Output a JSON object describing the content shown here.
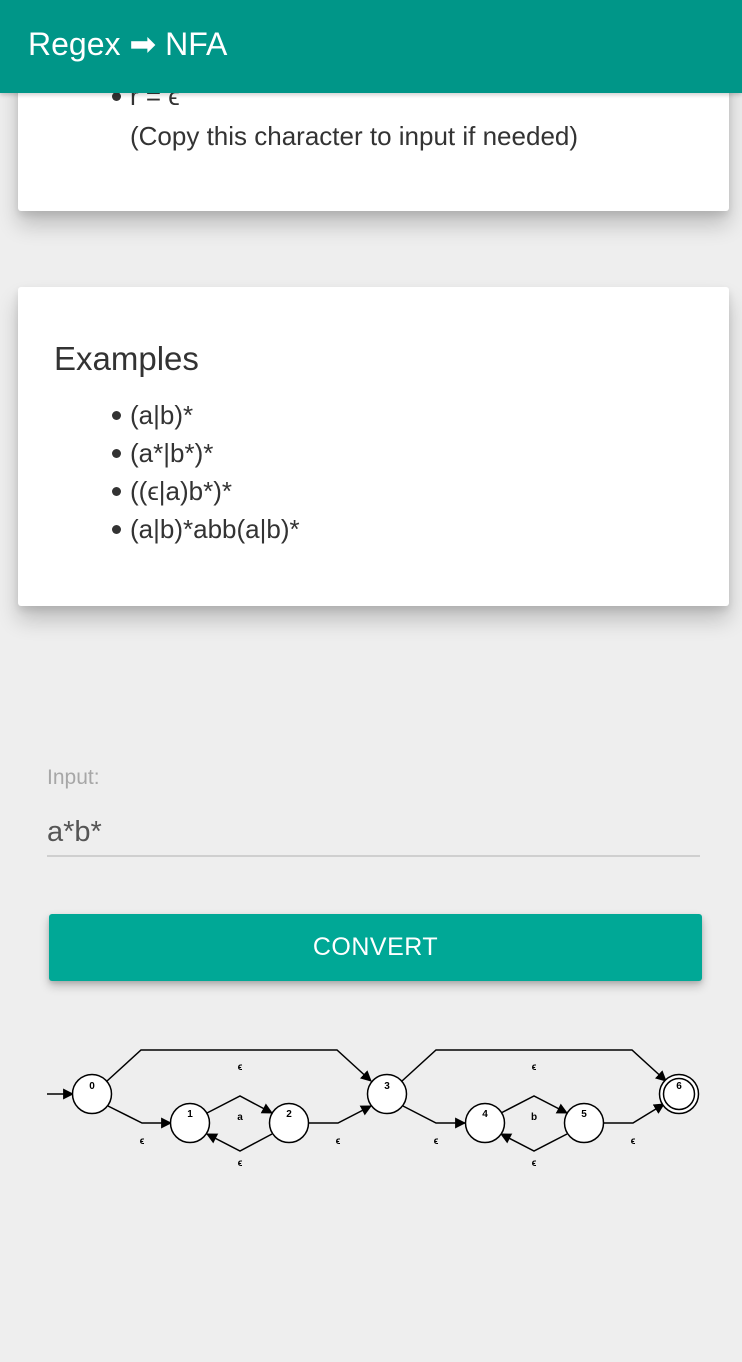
{
  "header": {
    "title": "Regex ➡ NFA"
  },
  "syntax_card": {
    "items": [
      {
        "label": "r = ϵ"
      }
    ],
    "note": "(Copy this character to input if needed)"
  },
  "examples_card": {
    "heading": "Examples",
    "items": [
      {
        "label": "(a|b)*"
      },
      {
        "label": "(a*|b*)*"
      },
      {
        "label": "((ϵ|a)b*)*"
      },
      {
        "label": "(a|b)*abb(a|b)*"
      }
    ]
  },
  "input": {
    "label": "Input:",
    "value": "a*b*"
  },
  "convert_button": {
    "label": "CONVERT"
  },
  "nfa": {
    "states": [
      {
        "label": "0",
        "start": true,
        "accept": false
      },
      {
        "label": "1",
        "start": false,
        "accept": false
      },
      {
        "label": "2",
        "start": false,
        "accept": false
      },
      {
        "label": "3",
        "start": false,
        "accept": false
      },
      {
        "label": "4",
        "start": false,
        "accept": false
      },
      {
        "label": "5",
        "start": false,
        "accept": false
      },
      {
        "label": "6",
        "start": false,
        "accept": true
      }
    ],
    "transitions": [
      {
        "from": "0",
        "to": "3",
        "symbol": "ϵ"
      },
      {
        "from": "0",
        "to": "1",
        "symbol": "ϵ"
      },
      {
        "from": "1",
        "to": "2",
        "symbol": "a"
      },
      {
        "from": "2",
        "to": "1",
        "symbol": "ϵ"
      },
      {
        "from": "2",
        "to": "3",
        "symbol": "ϵ"
      },
      {
        "from": "3",
        "to": "6",
        "symbol": "ϵ"
      },
      {
        "from": "3",
        "to": "4",
        "symbol": "ϵ"
      },
      {
        "from": "4",
        "to": "5",
        "symbol": "b"
      },
      {
        "from": "5",
        "to": "4",
        "symbol": "ϵ"
      },
      {
        "from": "5",
        "to": "6",
        "symbol": "ϵ"
      }
    ]
  },
  "colors": {
    "primary": "#009688",
    "button": "#00a896",
    "background": "#eeeeee",
    "card": "#ffffff"
  }
}
